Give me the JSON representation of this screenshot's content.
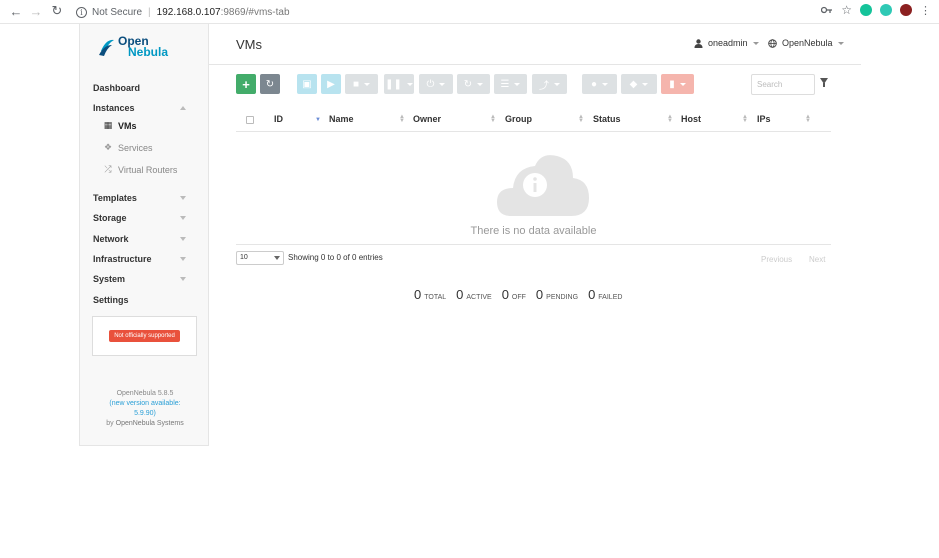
{
  "browser": {
    "security_label": "Not Secure",
    "url_host": "192.168.0.107",
    "url_path": ":9869/#vms-tab"
  },
  "brand": {
    "line1": "Open",
    "line2": "Nebula"
  },
  "sidebar": {
    "items": [
      {
        "label": "Dashboard"
      },
      {
        "label": "Instances"
      },
      {
        "label": "Templates"
      },
      {
        "label": "Storage"
      },
      {
        "label": "Network"
      },
      {
        "label": "Infrastructure"
      },
      {
        "label": "System"
      },
      {
        "label": "Settings"
      }
    ],
    "instances_sub": [
      {
        "label": "VMs",
        "icon": "grid-icon"
      },
      {
        "label": "Services",
        "icon": "cubes-icon"
      },
      {
        "label": "Virtual Routers",
        "icon": "random-icon"
      }
    ],
    "support_badge": "Not officially supported",
    "version": "OpenNebula 5.8.5",
    "new_version": "(new version available:",
    "new_version_num": "5.9.90)",
    "by_prefix": "by",
    "by": "OpenNebula Systems"
  },
  "header": {
    "title": "VMs",
    "user": "oneadmin",
    "zone": "OpenNebula"
  },
  "search": {
    "placeholder": "Search"
  },
  "table": {
    "columns": [
      "ID",
      "Name",
      "Owner",
      "Group",
      "Status",
      "Host",
      "IPs"
    ],
    "empty_message": "There is no data available",
    "page_length": "10",
    "showing": "Showing 0 to 0 of 0 entries",
    "previous": "Previous",
    "next": "Next"
  },
  "summary": [
    {
      "value": "0",
      "label": "TOTAL"
    },
    {
      "value": "0",
      "label": "ACTIVE"
    },
    {
      "value": "0",
      "label": "OFF"
    },
    {
      "value": "0",
      "label": "PENDING"
    },
    {
      "value": "0",
      "label": "FAILED"
    }
  ],
  "colors": {
    "create_button": "#43ac6a",
    "refresh_button": "#7c8790",
    "support_badge": "#e9513c",
    "link": "#2a9fd6"
  }
}
